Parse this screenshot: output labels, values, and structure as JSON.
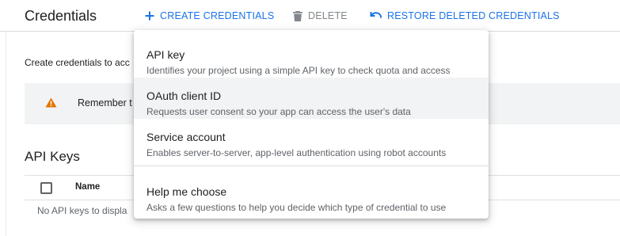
{
  "header": {
    "title": "Credentials",
    "create_label": "CREATE CREDENTIALS",
    "delete_label": "DELETE",
    "restore_label": "RESTORE DELETED CREDENTIALS"
  },
  "main": {
    "intro_text": "Create credentials to acc",
    "banner_text": "Remember t",
    "api_keys_title": "API Keys",
    "table": {
      "columns": [
        "Name"
      ],
      "empty_text": "No API keys to displa"
    }
  },
  "menu": {
    "items": [
      {
        "title": "API key",
        "description": "Identifies your project using a simple API key to check quota and access"
      },
      {
        "title": "OAuth client ID",
        "description": "Requests user consent so your app can access the user's data"
      },
      {
        "title": "Service account",
        "description": "Enables server-to-server, app-level authentication using robot accounts"
      },
      {
        "title": "Help me choose",
        "description": "Asks a few questions to help you decide which type of credential to use"
      }
    ],
    "highlighted_item": "OAuth client ID"
  },
  "colors": {
    "accent": "#1a73e8",
    "disabled": "#80868b",
    "warning": "#e37400",
    "hover": "#f1f3f4"
  },
  "icons": {
    "create": "plus-icon",
    "delete": "trash-icon",
    "restore": "undo-icon",
    "banner": "warning-icon"
  }
}
